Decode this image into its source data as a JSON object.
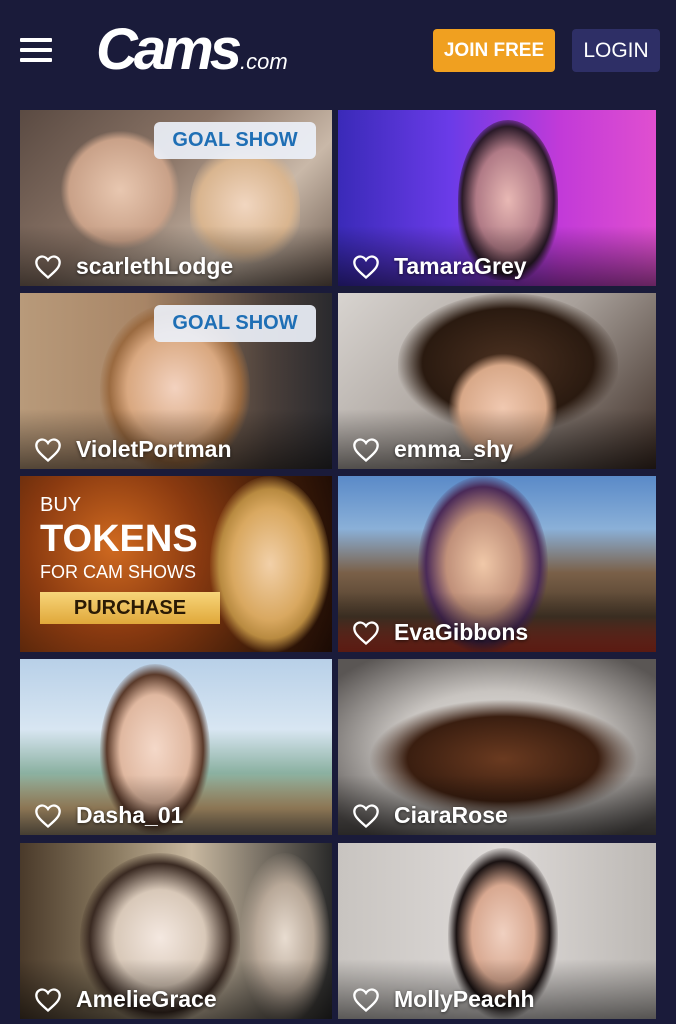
{
  "header": {
    "logo_main": "Cams",
    "logo_tld": ".com",
    "join_label": "JOIN FREE",
    "login_label": "LOGIN"
  },
  "colors": {
    "background": "#1a1b3a",
    "join_button": "#f0a020",
    "login_button": "#2e2f66",
    "goal_badge_text": "#1f6fb5"
  },
  "tiles": [
    {
      "name": "scarlethLodge",
      "badge": "GOAL SHOW"
    },
    {
      "name": "TamaraGrey"
    },
    {
      "name": "VioletPortman",
      "badge": "GOAL SHOW"
    },
    {
      "name": "emma_shy"
    },
    {
      "promo": true
    },
    {
      "name": "EvaGibbons"
    },
    {
      "name": "Dasha_01"
    },
    {
      "name": "CiaraRose"
    },
    {
      "name": "AmelieGrace"
    },
    {
      "name": "MollyPeachh"
    }
  ],
  "promo": {
    "line1": "BUY",
    "line2": "TOKENS",
    "line3": "FOR CAM SHOWS",
    "button": "PURCHASE"
  }
}
